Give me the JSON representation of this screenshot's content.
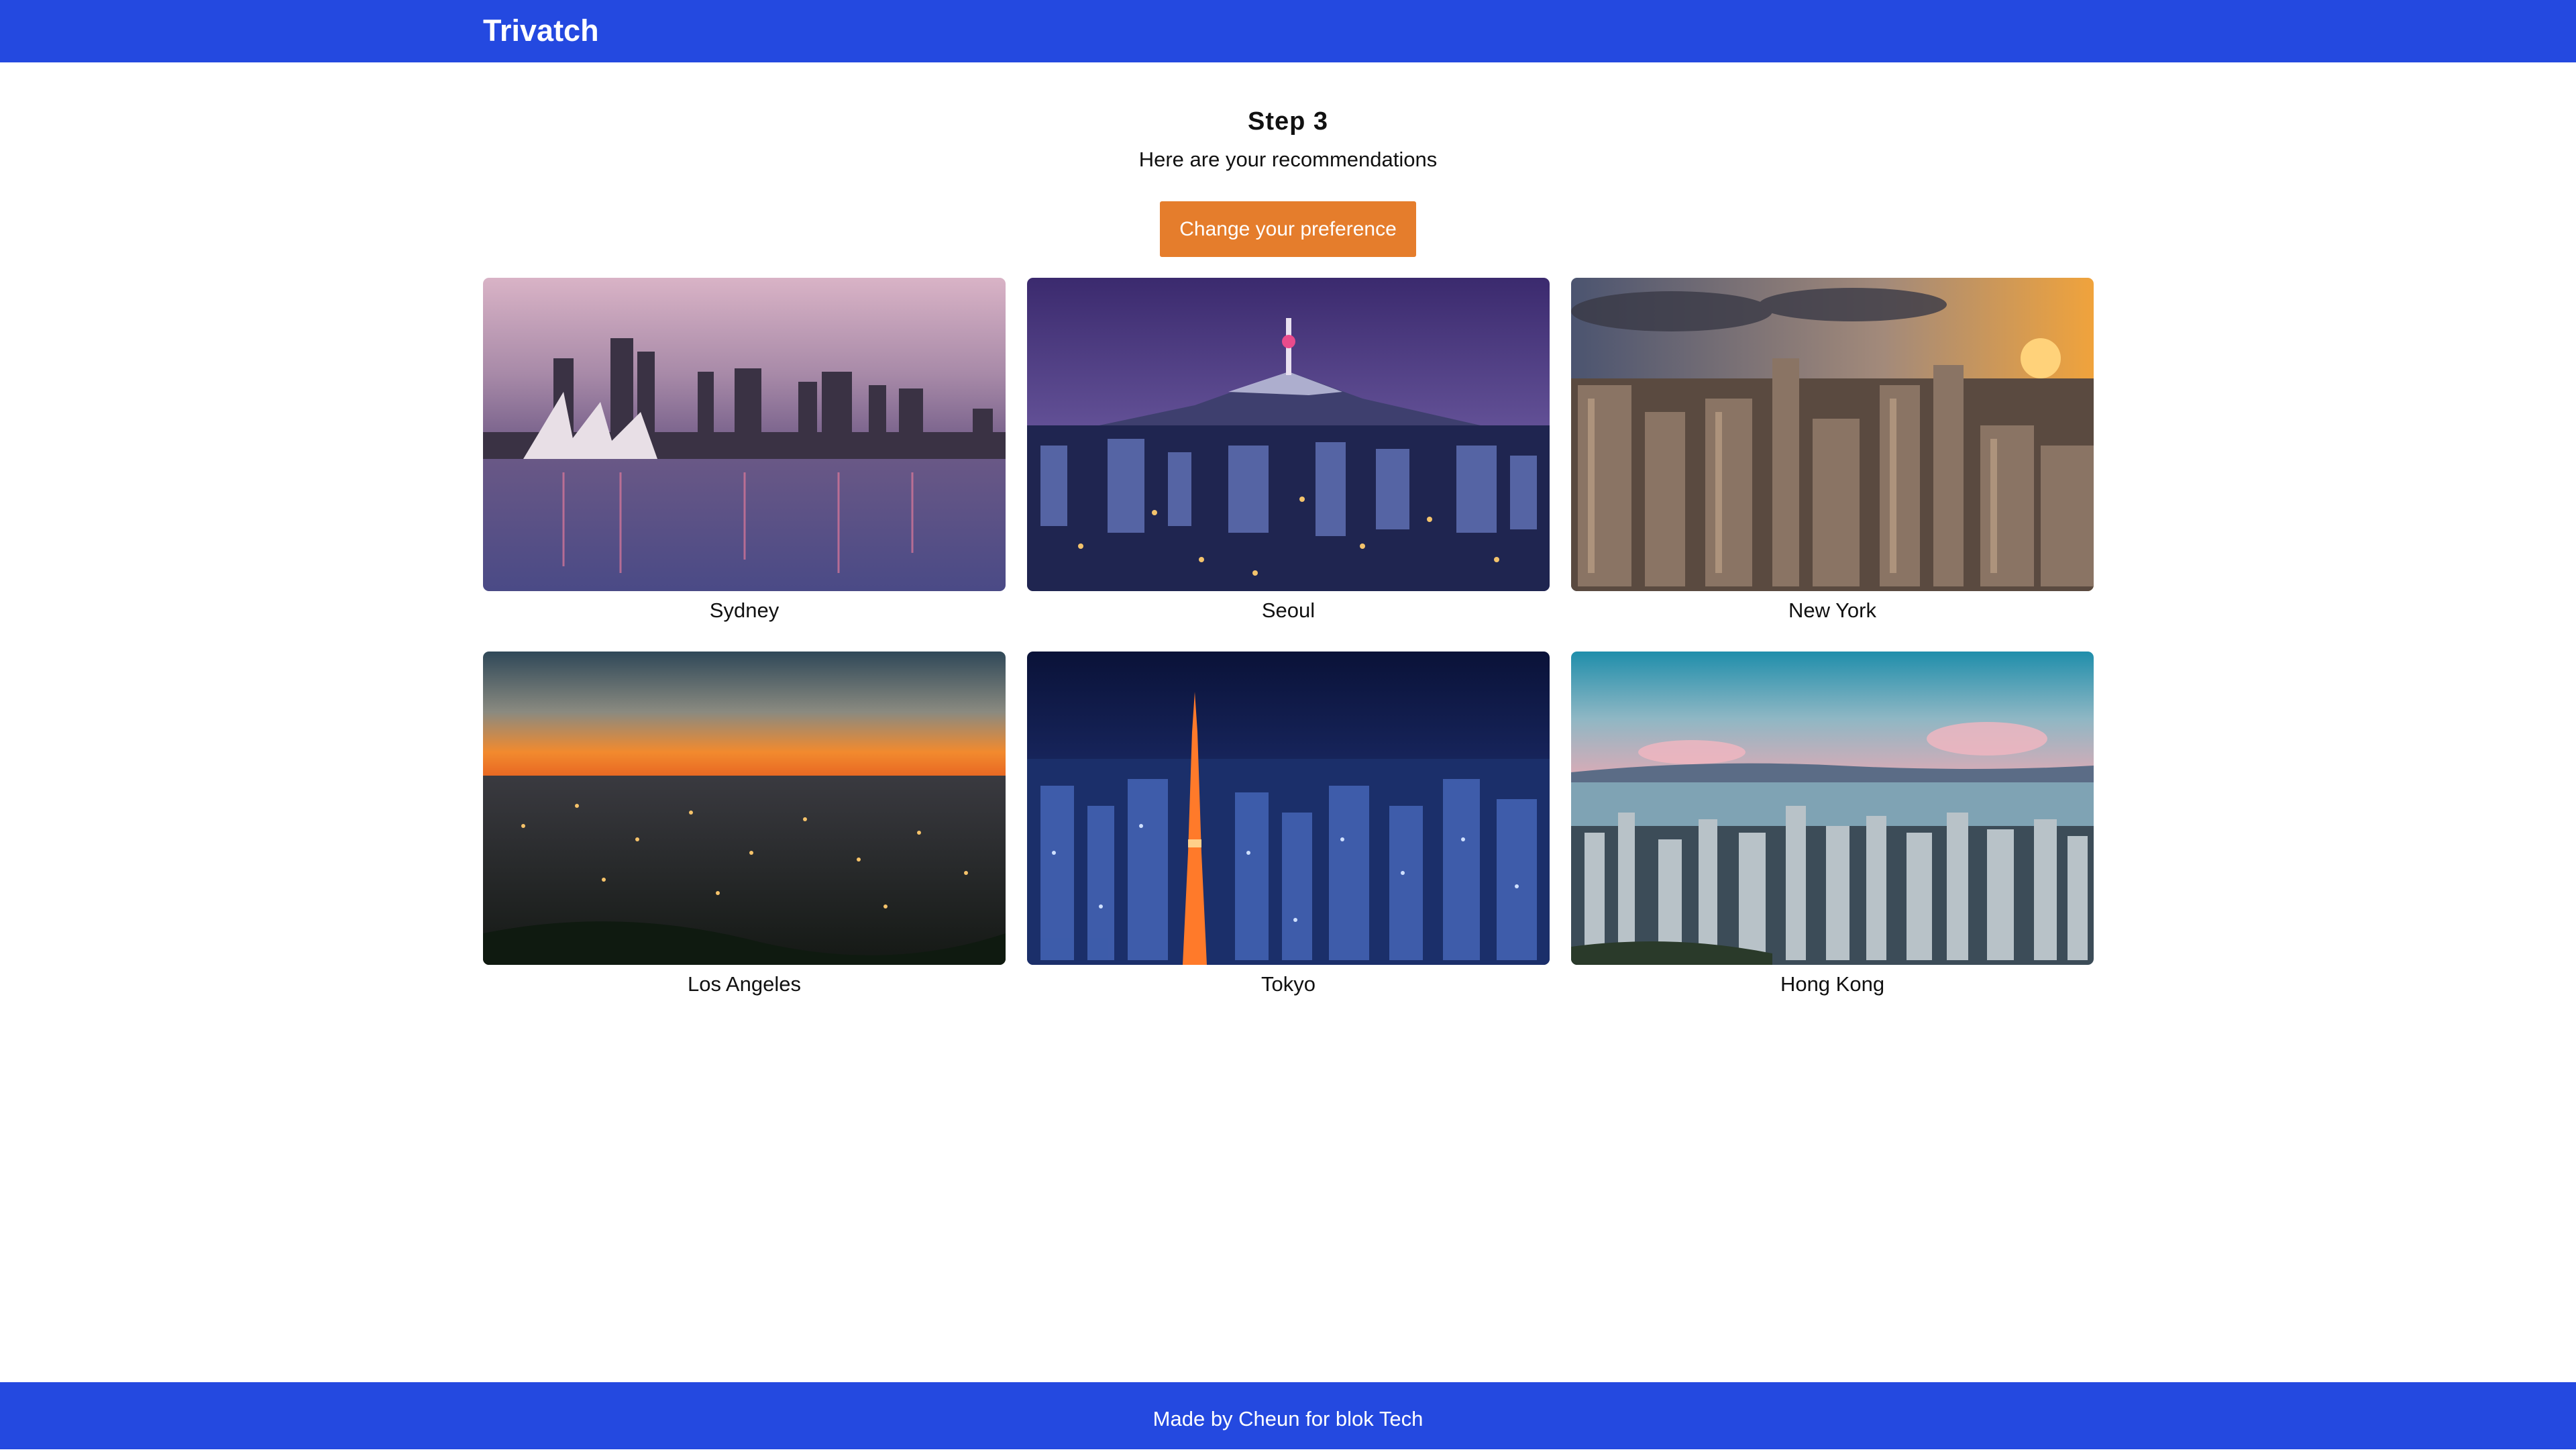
{
  "header": {
    "brand": "Trivatch"
  },
  "main": {
    "step_title": "Step 3",
    "step_subtitle": "Here are your recommendations",
    "change_button": "Change your preference",
    "recommendations": [
      {
        "city": "Sydney"
      },
      {
        "city": "Seoul"
      },
      {
        "city": "New York"
      },
      {
        "city": "Los Angeles"
      },
      {
        "city": "Tokyo"
      },
      {
        "city": "Hong Kong"
      }
    ]
  },
  "footer": {
    "text": "Made by Cheun for blok Tech"
  },
  "colors": {
    "brand_blue": "#2449e0",
    "accent_orange": "#e57d2c"
  }
}
